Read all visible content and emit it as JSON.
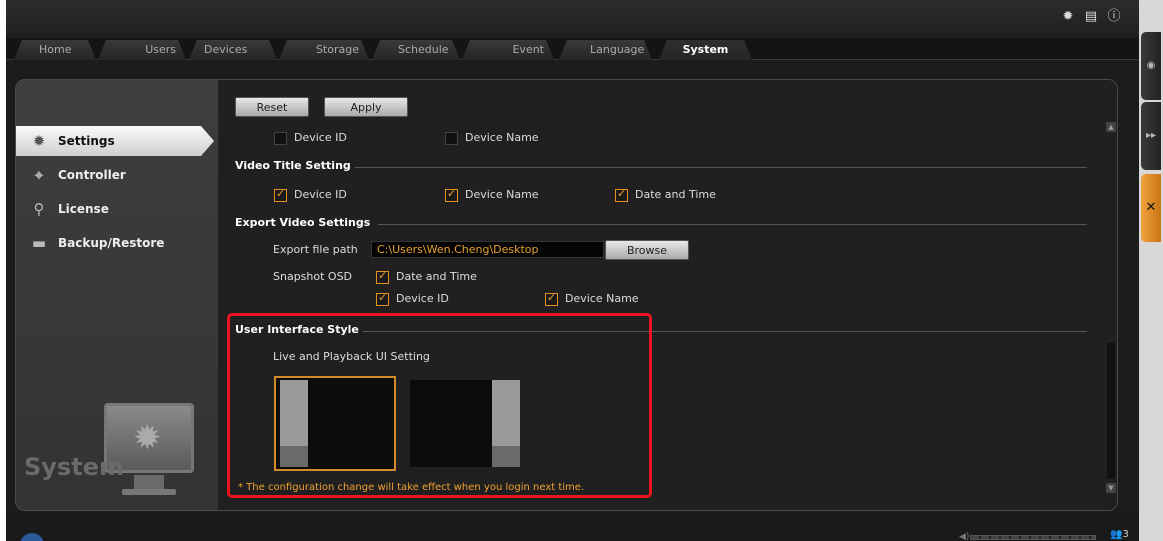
{
  "topbar": {
    "icons": [
      "gear-icon",
      "document-icon",
      "info-icon"
    ]
  },
  "tabs": [
    {
      "label": "Home"
    },
    {
      "label": "Users"
    },
    {
      "label": "Devices"
    },
    {
      "label": "Storage"
    },
    {
      "label": "Schedule"
    },
    {
      "label": "Event"
    },
    {
      "label": "Language"
    },
    {
      "label": "System",
      "active": true
    }
  ],
  "sidebar": {
    "items": [
      {
        "label": "Settings",
        "icon": "gear-icon",
        "active": true
      },
      {
        "label": "Controller",
        "icon": "joystick-icon"
      },
      {
        "label": "License",
        "icon": "key-icon"
      },
      {
        "label": "Backup/Restore",
        "icon": "folder-icon"
      }
    ],
    "logo_text": "System"
  },
  "toolbar": {
    "reset_label": "Reset",
    "apply_label": "Apply"
  },
  "top_checkboxes": {
    "device_id": {
      "label": "Device ID",
      "checked": false
    },
    "device_name": {
      "label": "Device Name",
      "checked": false
    }
  },
  "video_title": {
    "heading": "Video Title Setting",
    "device_id": {
      "label": "Device ID",
      "checked": true
    },
    "device_name": {
      "label": "Device Name",
      "checked": true
    },
    "date_time": {
      "label": "Date and Time",
      "checked": true
    }
  },
  "export": {
    "heading": "Export Video Settings",
    "path_label": "Export file path",
    "path_value": "C:\\Users\\Wen.Cheng\\Desktop",
    "browse_label": "Browse",
    "snapshot_label": "Snapshot OSD",
    "snap_date_time": {
      "label": "Date and Time",
      "checked": true
    },
    "snap_device_id": {
      "label": "Device ID",
      "checked": true
    },
    "snap_device_name": {
      "label": "Device Name",
      "checked": true
    }
  },
  "ui_style": {
    "heading": "User Interface Style",
    "sub_label": "Live and Playback UI Setting",
    "options": [
      "left-panel-layout",
      "right-panel-layout"
    ],
    "selected": "left-panel-layout",
    "note": "* The configuration change will take effect when you login next time."
  },
  "statusbar": {
    "user_count": "3"
  },
  "colors": {
    "accent": "#e8901e",
    "highlight_box": "#e8141e",
    "note_text": "#f0a030"
  }
}
